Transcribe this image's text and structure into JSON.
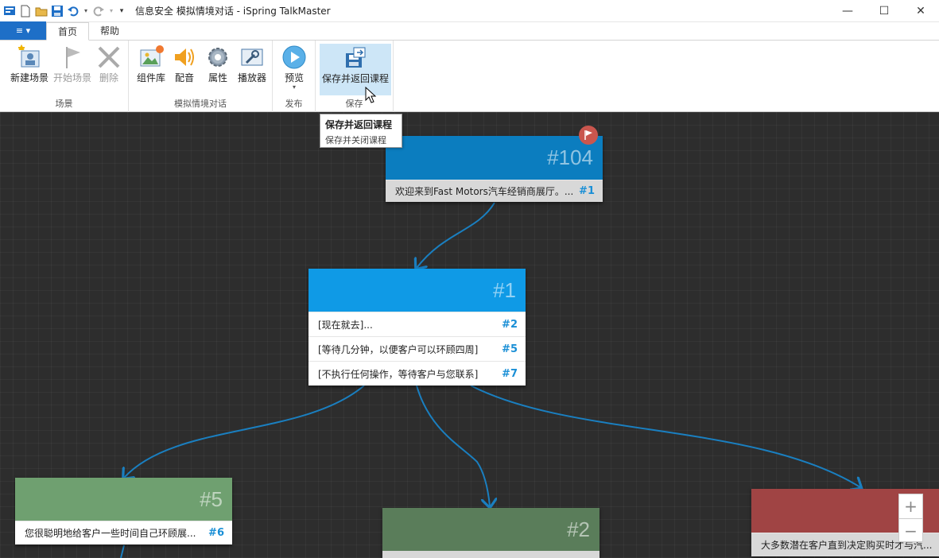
{
  "window": {
    "title": "信息安全 模拟情境对话 - iSpring TalkMaster",
    "minimize": "—",
    "maximize": "☐",
    "close": "✕"
  },
  "tabs": {
    "file_icon": "≡ ▾",
    "items": [
      {
        "label": "首页",
        "active": true
      },
      {
        "label": "帮助",
        "active": false
      }
    ]
  },
  "ribbon": {
    "groups": [
      {
        "label": "场景",
        "buttons": [
          {
            "label": "新建场景",
            "icon": "new-scene-icon",
            "disabled": false
          },
          {
            "label": "开始场景",
            "icon": "flag-icon",
            "disabled": true
          },
          {
            "label": "删除",
            "icon": "delete-icon",
            "disabled": true
          }
        ]
      },
      {
        "label": "模拟情境对话",
        "buttons": [
          {
            "label": "组件库",
            "icon": "library-icon",
            "disabled": false
          },
          {
            "label": "配音",
            "icon": "speaker-icon",
            "disabled": false
          },
          {
            "label": "属性",
            "icon": "gear-icon",
            "disabled": false
          },
          {
            "label": "播放器",
            "icon": "wrench-icon",
            "disabled": false
          }
        ]
      },
      {
        "label": "发布",
        "buttons": [
          {
            "label": "预览",
            "icon": "play-icon",
            "disabled": false
          }
        ]
      },
      {
        "label": "保存",
        "buttons": [
          {
            "label": "保存并返回课程",
            "icon": "save-return-icon",
            "disabled": false
          }
        ]
      }
    ]
  },
  "tooltip": {
    "title": "保存并返回课程",
    "description": "保存并关闭课程"
  },
  "nodes": {
    "n104": {
      "id": "#104",
      "color": "#0b7dbf",
      "rows": [
        {
          "text": "欢迎来到Fast Motors汽车经销商展厅。...",
          "ref": "#1"
        }
      ]
    },
    "n1": {
      "id": "#1",
      "color": "#0f9ae6",
      "rows": [
        {
          "text": "[现在就去]...",
          "ref": "#2"
        },
        {
          "text": "[等待几分钟，以便客户可以环顾四周]",
          "ref": "#5"
        },
        {
          "text": "[不执行任何操作，等待客户与您联系]",
          "ref": "#7"
        }
      ]
    },
    "n5": {
      "id": "#5",
      "color": "#6fa070",
      "rows": [
        {
          "text": "您很聪明地给客户一些时间自己环顾展...",
          "ref": "#6"
        }
      ]
    },
    "n2": {
      "id": "#2",
      "color": "#5a7d5a"
    },
    "n7": {
      "color": "#a04444",
      "rows": [
        {
          "text": "大多数潜在客户直到决定购买时才与汽..."
        }
      ]
    }
  },
  "zoom": {
    "in": "+",
    "out": "−"
  },
  "colors": {
    "link": "#1a7fc0",
    "accent": "#1e6fc7"
  }
}
